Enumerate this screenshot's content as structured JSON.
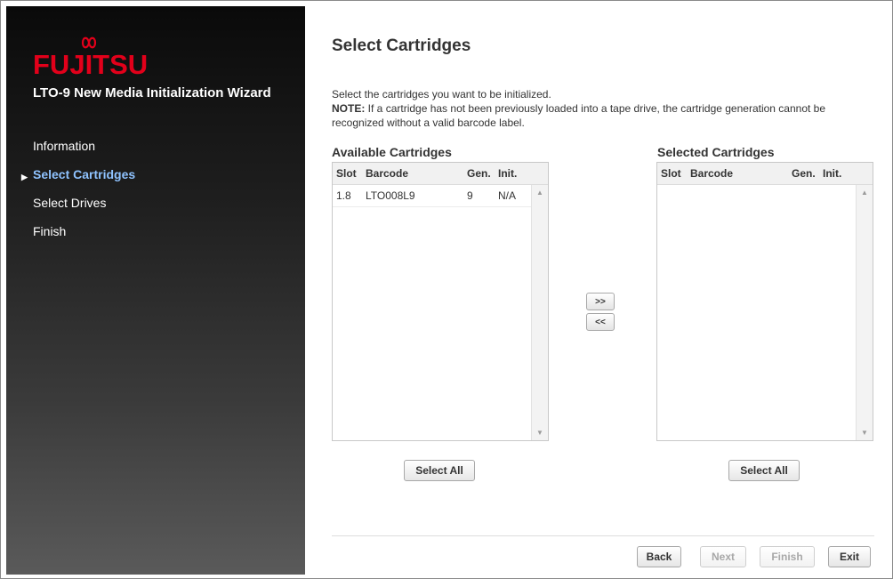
{
  "sidebar": {
    "logo_text": "FUJITSU",
    "wizard_title": "LTO-9 New Media Initialization Wizard",
    "items": [
      {
        "label": "Information",
        "active": false
      },
      {
        "label": "Select Cartridges",
        "active": true
      },
      {
        "label": "Select Drives",
        "active": false
      },
      {
        "label": "Finish",
        "active": false
      }
    ]
  },
  "main": {
    "title": "Select Cartridges",
    "description": "Select the cartridges you want to be initialized.",
    "note_label": "NOTE:",
    "note_text": " If a cartridge has not been previously loaded into a tape drive, the cartridge generation cannot be recognized without a valid barcode label."
  },
  "available": {
    "title": "Available Cartridges",
    "columns": {
      "slot": "Slot",
      "barcode": "Barcode",
      "gen": "Gen.",
      "init": "Init."
    },
    "rows": [
      {
        "slot": "1.8",
        "barcode": "LTO008L9",
        "gen": "9",
        "init": "N/A"
      }
    ],
    "select_all": "Select All"
  },
  "selected": {
    "title": "Selected Cartridges",
    "columns": {
      "slot": "Slot",
      "barcode": "Barcode",
      "gen": "Gen.",
      "init": "Init."
    },
    "rows": [],
    "select_all": "Select All"
  },
  "transfer": {
    "add_label": ">>",
    "remove_label": "<<"
  },
  "footer": {
    "back": "Back",
    "next": "Next",
    "finish": "Finish",
    "exit": "Exit",
    "next_enabled": false,
    "finish_enabled": false
  },
  "colors": {
    "brand_red": "#e2001a",
    "active_nav": "#8fc3ff"
  }
}
